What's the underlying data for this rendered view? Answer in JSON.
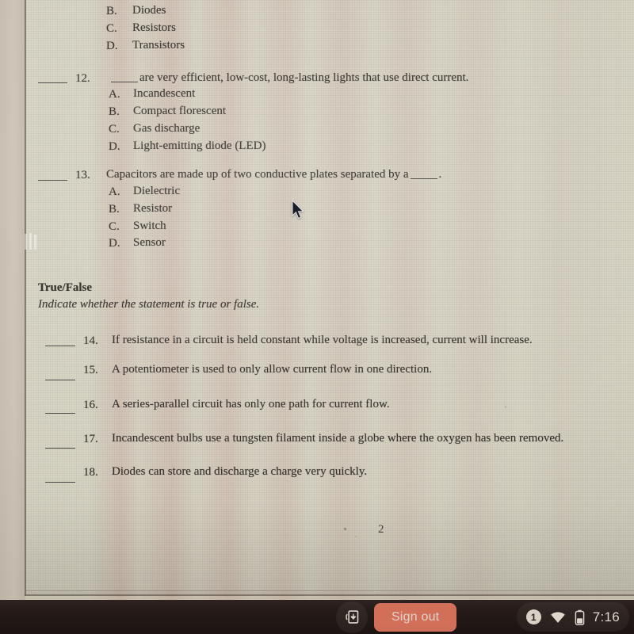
{
  "document": {
    "page_number": "2",
    "partial_question_top": {
      "options": [
        {
          "letter": "B.",
          "text": "Diodes"
        },
        {
          "letter": "C.",
          "text": "Resistors"
        },
        {
          "letter": "D.",
          "text": "Transistors"
        }
      ]
    },
    "questions": [
      {
        "number": "12.",
        "stem_prefix": "",
        "stem": "are very efficient, low-cost, long-lasting lights that use direct current.",
        "has_leading_inline_blank": true,
        "options": [
          {
            "letter": "A.",
            "text": "Incandescent"
          },
          {
            "letter": "B.",
            "text": "Compact florescent"
          },
          {
            "letter": "C.",
            "text": "Gas discharge"
          },
          {
            "letter": "D.",
            "text": "Light-emitting diode (LED)"
          }
        ]
      },
      {
        "number": "13.",
        "stem_prefix": "Capacitors are made up of two conductive plates separated by a",
        "stem": ".",
        "has_leading_inline_blank": false,
        "options": [
          {
            "letter": "A.",
            "text": "Dielectric"
          },
          {
            "letter": "B.",
            "text": "Resistor"
          },
          {
            "letter": "C.",
            "text": "Switch"
          },
          {
            "letter": "D.",
            "text": "Sensor"
          }
        ]
      }
    ],
    "true_false_section": {
      "heading": "True/False",
      "instruction": "Indicate whether the statement is true or false.",
      "items": [
        {
          "number": "14.",
          "text": "If resistance in a circuit is held constant while voltage is increased, current will increase."
        },
        {
          "number": "15.",
          "text": "A potentiometer is used to only allow current flow in one direction."
        },
        {
          "number": "16.",
          "text": "A series-parallel circuit has only one path for current flow."
        },
        {
          "number": "17.",
          "text": "Incandescent bulbs use a tungsten filament inside a globe where the oxygen has been removed."
        },
        {
          "number": "18.",
          "text": "Diodes can store and discharge a charge very quickly."
        }
      ]
    }
  },
  "shelf": {
    "sign_out_label": "Sign out",
    "notification_count": "1",
    "time": "7:16",
    "icons": {
      "download": "download-icon",
      "wifi": "wifi-icon",
      "battery": "battery-icon"
    }
  },
  "colors": {
    "paper": "#d7d4c4",
    "ink": "#34312c",
    "shelf": "#241a18",
    "accent": "#e0775f"
  }
}
